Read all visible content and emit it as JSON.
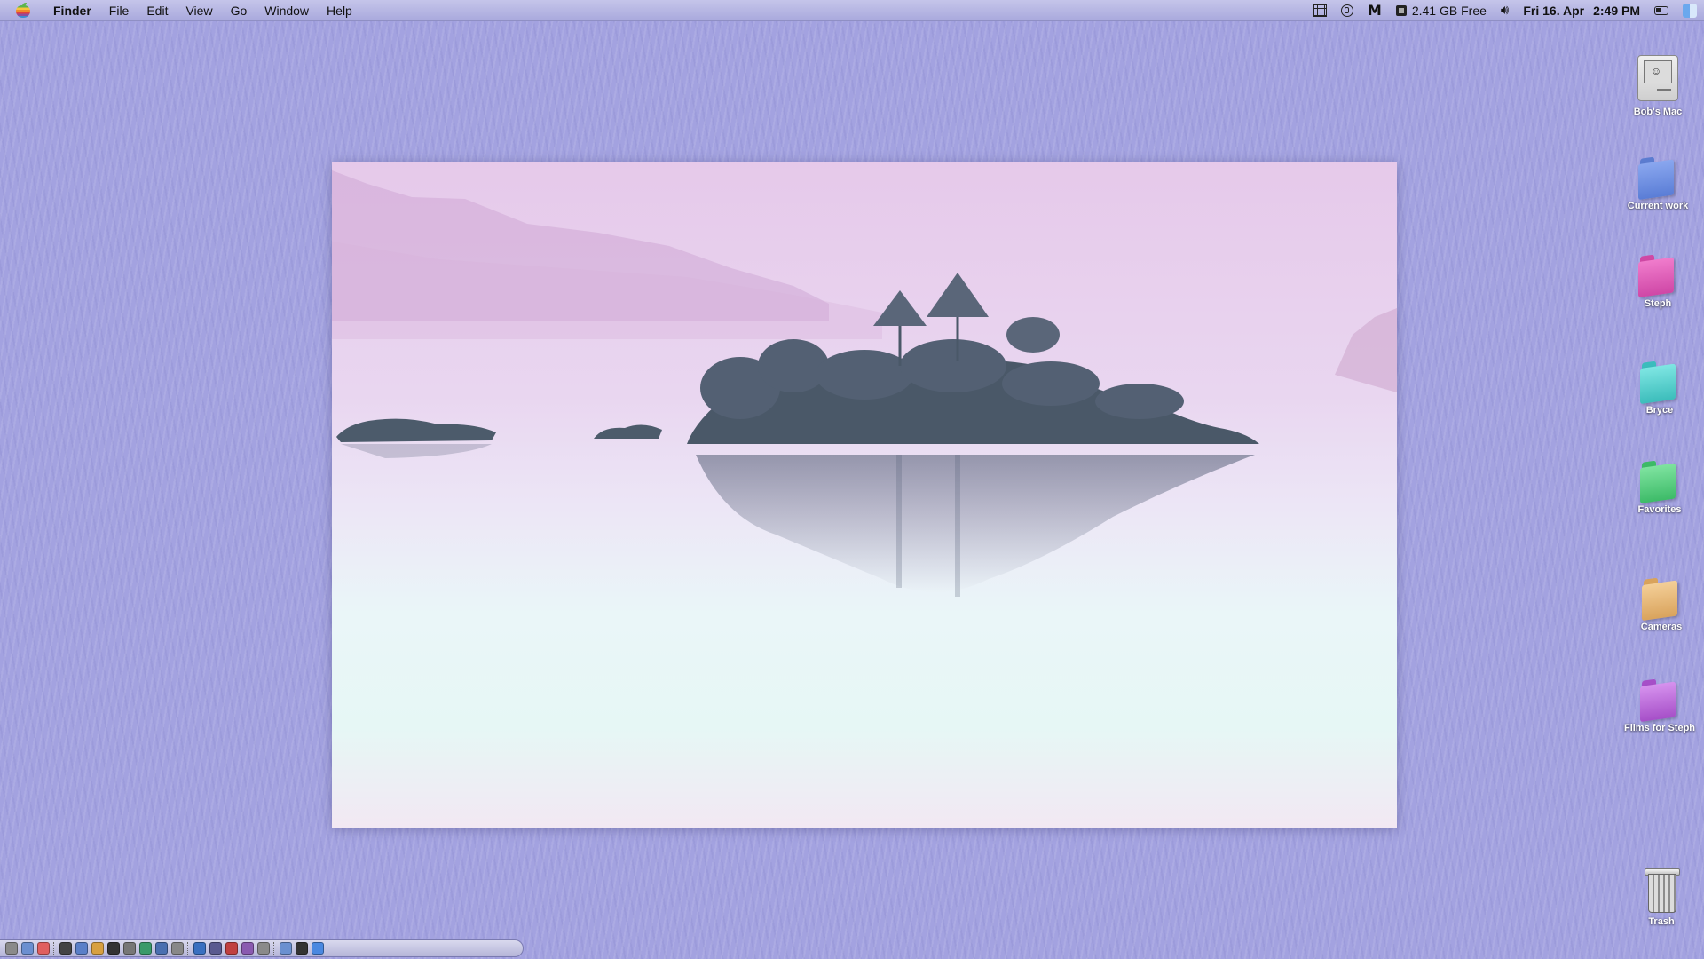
{
  "menubar": {
    "app_name": "Finder",
    "items": [
      {
        "label": "File"
      },
      {
        "label": "Edit"
      },
      {
        "label": "View"
      },
      {
        "label": "Go"
      },
      {
        "label": "Window"
      },
      {
        "label": "Help"
      }
    ],
    "status": {
      "memory_text": "2.41 GB Free",
      "date_text": "Fri 16. Apr",
      "time_text": "2:49 PM",
      "icons": [
        "calendar-grid-icon",
        "timer-icon",
        "malwarebytes-icon",
        "memory-chip-icon",
        "speaker-icon",
        "control-strip-icon",
        "finder-icon"
      ]
    }
  },
  "desktop": {
    "icons": [
      {
        "label": "Bob's Mac",
        "type": "computer"
      },
      {
        "label": "Current work",
        "type": "folder",
        "color": "#6f8fe0"
      },
      {
        "label": "Steph",
        "type": "folder",
        "color": "#e05fb8"
      },
      {
        "label": "Bryce",
        "type": "folder",
        "color": "#4fd0cf"
      },
      {
        "label": "Favorites",
        "type": "folder",
        "color": "#4fce7a"
      },
      {
        "label": "Cameras",
        "type": "folder",
        "color": "#e8b46e"
      },
      {
        "label": "Films for Steph",
        "type": "folder",
        "color": "#b862d8"
      },
      {
        "label": "Trash",
        "type": "trash"
      }
    ]
  },
  "colors": {
    "desktop_background": "#a3a2e0",
    "menubar": "#b9b9e3"
  },
  "control_strip": {
    "modules": [
      "#8a8a8a",
      "#6b8fd0",
      "#e05f5f",
      "#444",
      "#5a7fc8",
      "#d8a040",
      "#333",
      "#777",
      "#3a9a6a",
      "#4a6fb0",
      "#888",
      "#3a70c0",
      "#5a5a90",
      "#c04040",
      "#8a5ab0",
      "#8a8a8a",
      "#6a90d0",
      "#333",
      "#4a88e0"
    ]
  }
}
